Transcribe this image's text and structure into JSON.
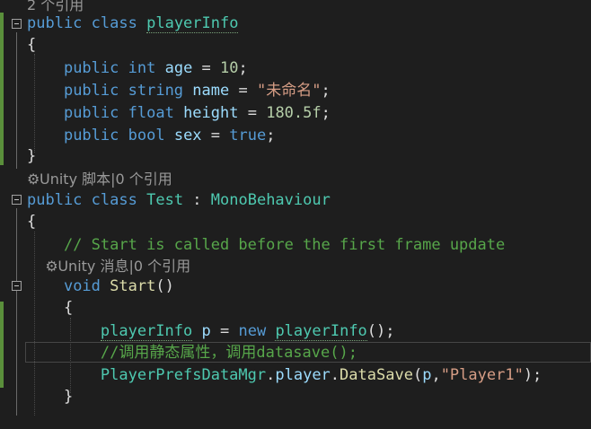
{
  "lines": {
    "l0": "2 个引用",
    "l1_kw1": "public",
    "l1_kw2": "class",
    "l1_ty": "playerInfo",
    "l2": "{",
    "l3_kw1": "public",
    "l3_kw2": "int",
    "l3_id": "age",
    "l3_eq": " = ",
    "l3_num": "10",
    "l3_end": ";",
    "l4_kw1": "public",
    "l4_kw2": "string",
    "l4_id": "name",
    "l4_eq": " = ",
    "l4_str": "\"未命名\"",
    "l4_end": ";",
    "l5_kw1": "public",
    "l5_kw2": "float",
    "l5_id": "height",
    "l5_eq": " = ",
    "l5_num": "180.5f",
    "l5_end": ";",
    "l6_kw1": "public",
    "l6_kw2": "bool",
    "l6_id": "sex",
    "l6_eq": " = ",
    "l6_kw3": "true",
    "l6_end": ";",
    "l7": "}",
    "l8_lens": "Unity 脚本|0 个引用",
    "l9_kw1": "public",
    "l9_kw2": "class",
    "l9_ty": "Test",
    "l9_sep": " : ",
    "l9_base": "MonoBehaviour",
    "l10": "{",
    "l11_cm": "// Start is called before the first frame update",
    "l12_lens": "Unity 消息|0 个引用",
    "l13_kw": "void",
    "l13_fn": "Start",
    "l13_par": "()",
    "l14": "{",
    "l15_ty": "playerInfo",
    "l15_id": "p",
    "l15_eq": " = ",
    "l15_kw": "new",
    "l15_ty2": "playerInfo",
    "l15_end": "();",
    "l16_cm": "//调用静态属性，调用datasave();",
    "l17_ty": "PlayerPrefsDataMgr",
    "l17_dot1": ".",
    "l17_id": "player",
    "l17_dot2": ".",
    "l17_fn": "DataSave",
    "l17_open": "(",
    "l17_arg": "p",
    "l17_comma": ",",
    "l17_str": "\"Player1\"",
    "l17_end": ");",
    "l18": "}"
  },
  "icons": {
    "codelens": "unity-component-icon",
    "collapse": "collapse-minus-icon"
  },
  "colors": {
    "background": "#1e1e1e",
    "keyword": "#569cd6",
    "type": "#4ec9b0",
    "comment": "#57a64a",
    "string": "#d69d85",
    "number": "#b5cea8",
    "change-marker": "#5a8f3b"
  }
}
